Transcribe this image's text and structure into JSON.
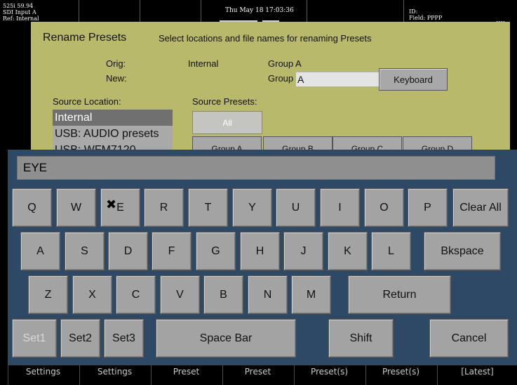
{
  "status_bar": {
    "signal_info": "525i 59.94\nSDI Input A\nRef: Internal",
    "date": "Thu May 18 17:03:36",
    "id_info": "ID:\nField: PPPP",
    "dashes": "----"
  },
  "dialog": {
    "title": "Rename Presets",
    "subtitle": "Select locations and file names for renaming Presets",
    "orig_label": "Orig:",
    "new_label": "New:",
    "orig_location": "Internal",
    "orig_name": "Group A",
    "new_prefix": "Group",
    "new_value": "A",
    "keyboard_button": "Keyboard",
    "source_location_label": "Source Location:",
    "source_presets_label": "Source Presets:",
    "source_locations": [
      "Internal",
      "USB: AUDIO presets",
      "USB: WFM7120"
    ],
    "all_button": "All",
    "groups": [
      "Group A",
      "Group B",
      "Group C",
      "Group D"
    ]
  },
  "keyboard": {
    "input_value": "EYE",
    "row1": [
      "Q",
      "W",
      "E",
      "R",
      "T",
      "Y",
      "U",
      "I",
      "O",
      "P",
      "Clear All"
    ],
    "row2": [
      "A",
      "S",
      "D",
      "F",
      "G",
      "H",
      "J",
      "K",
      "L",
      "Bkspace"
    ],
    "row3": [
      "Z",
      "X",
      "C",
      "V",
      "B",
      "N",
      "M",
      "Return"
    ],
    "row4": [
      "Set1",
      "Set2",
      "Set3",
      "Space Bar",
      "Shift",
      "Cancel"
    ]
  },
  "bottom_menu": [
    "Settings",
    "Settings",
    "Preset",
    "Preset",
    "Preset(s)",
    "Preset(s)",
    "[Latest]"
  ]
}
